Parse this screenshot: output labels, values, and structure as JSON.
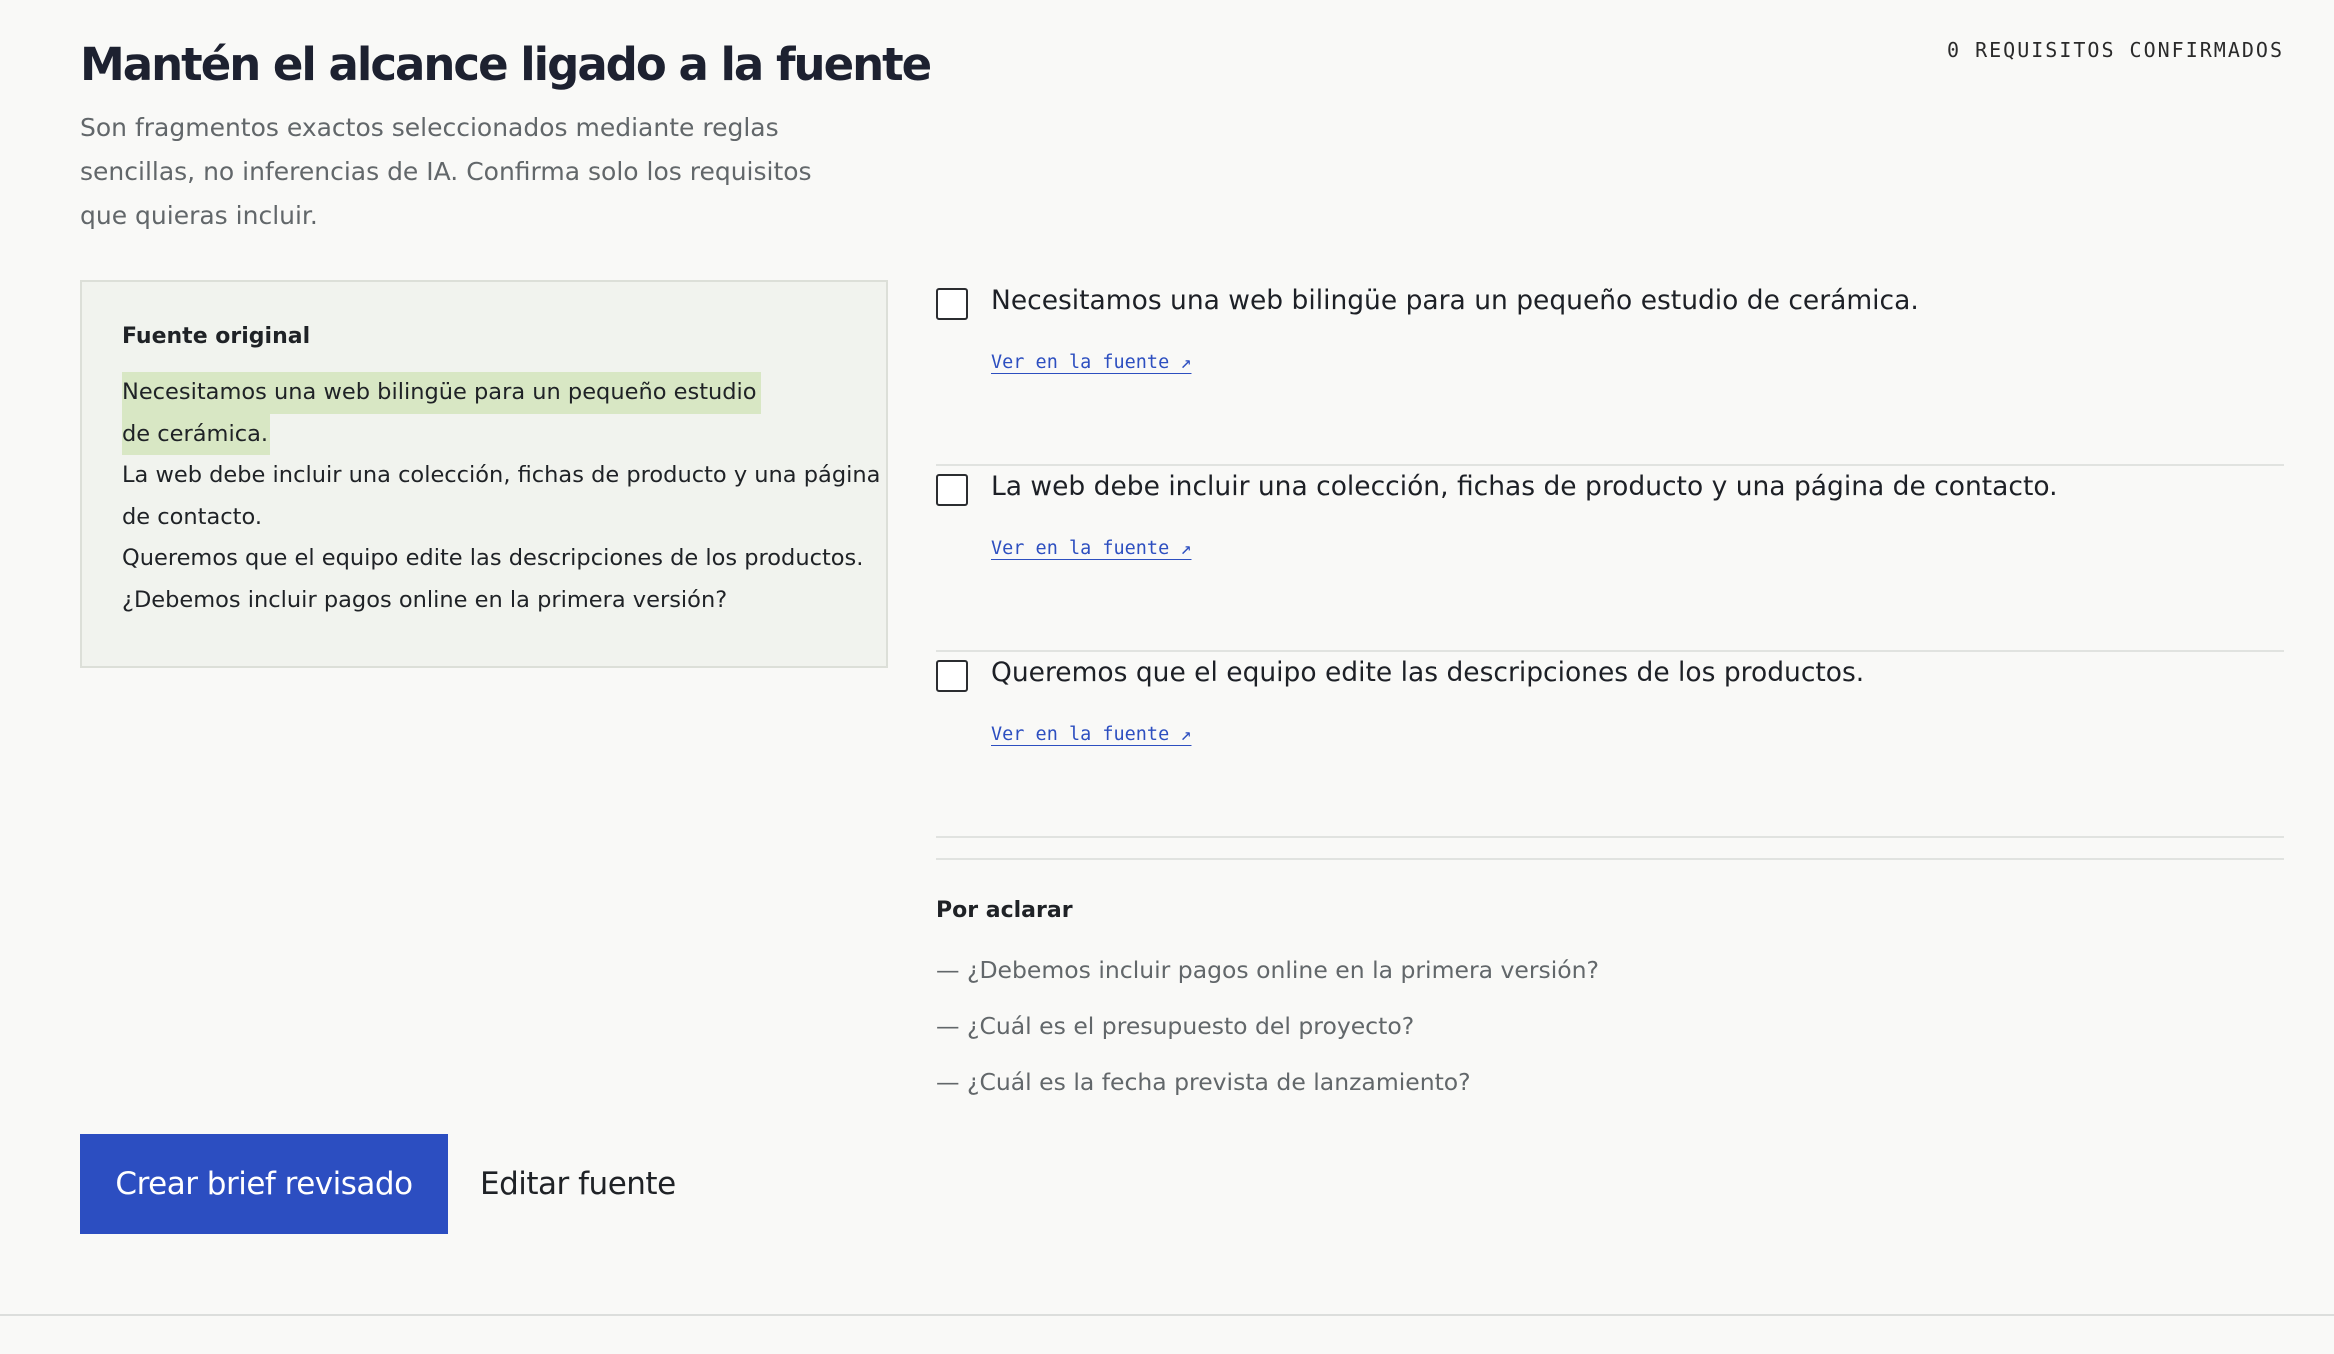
{
  "header": {
    "title": "Mantén el alcance ligado a la fuente",
    "subtitle": "Son fragmentos exactos seleccionados mediante reglas sencillas, no inferencias de IA. Confirma solo los requisitos que quieras incluir.",
    "confirmed_count": "0 REQUISITOS CONFIRMADOS"
  },
  "source": {
    "heading": "Fuente original",
    "lines": [
      "Necesitamos una web bilingüe para un pequeño estudio",
      "de cerámica.",
      "La web debe incluir una colección, fichas de producto y una página",
      "de contacto.",
      "Queremos que el equipo edite las descripciones de los productos.",
      "¿Debemos incluir pagos online en la primera versión?"
    ],
    "highlight_color": "#d8e7c4"
  },
  "requirements": [
    {
      "text": "Necesitamos una web bilingüe para un pequeño estudio de cerámica.",
      "link": "Ver en la fuente ↗",
      "checked": false
    },
    {
      "text": "La web debe incluir una colección, fichas de producto y una página de contacto.",
      "link": "Ver en la fuente ↗",
      "checked": false
    },
    {
      "text": "Queremos que el equipo edite las descripciones de los productos.",
      "link": "Ver en la fuente ↗",
      "checked": false
    }
  ],
  "clarify": {
    "heading": "Por aclarar",
    "items": [
      "— ¿Debemos incluir pagos online en la primera versión?",
      "— ¿Cuál es el presupuesto del proyecto?",
      "— ¿Cuál es la fecha prevista de lanzamiento?"
    ]
  },
  "actions": {
    "primary_label": "Crear brief revisado",
    "secondary_label": "Editar fuente"
  },
  "colors": {
    "accent": "#2c4ec1",
    "background": "#f9f9f7",
    "panel": "#f1f3ee"
  }
}
